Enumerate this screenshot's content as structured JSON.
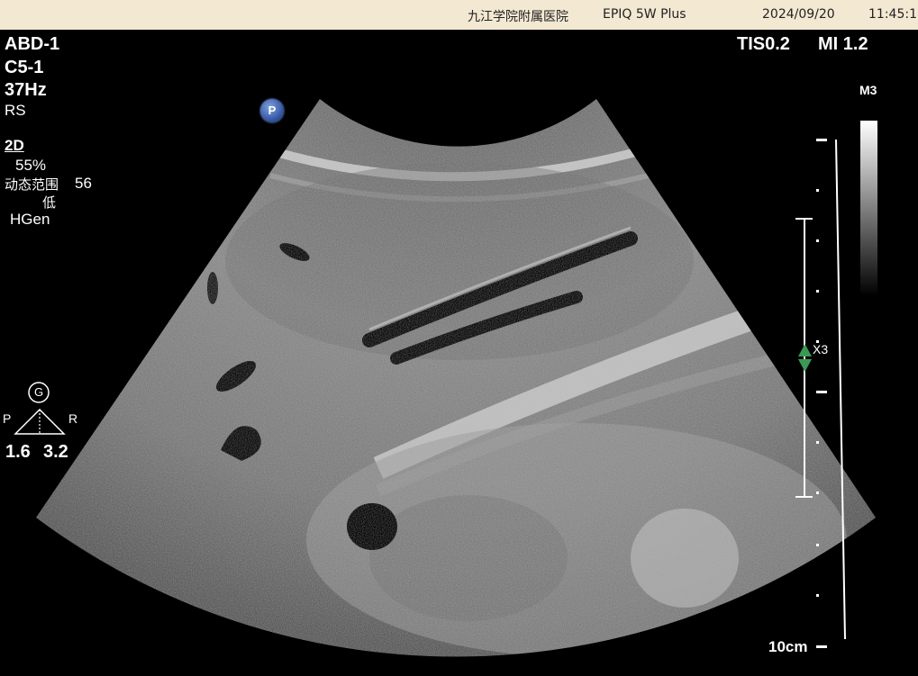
{
  "header": {
    "hospital": "九江学院附属医院",
    "device": "EPIQ 5W Plus",
    "date": "2024/09/20",
    "time": "11:45:17"
  },
  "left_panel": {
    "preset": "ABD-1",
    "probe": "C5-1",
    "frequency": "37Hz",
    "resolution": "RS",
    "mode": "2D",
    "gain": "55%",
    "dynamic_range_label": "动态范围",
    "dynamic_range_value": "56",
    "level": "低",
    "harmonic": "HGen"
  },
  "orientation": {
    "g_label": "G",
    "p_label": "P",
    "r_label": "R",
    "p_value": "1.6",
    "r_value": "3.2"
  },
  "right_panel": {
    "tis": "TIS0.2",
    "mi": "MI 1.2",
    "map": "M3",
    "focus_marker": "X3",
    "depth": "10cm"
  },
  "probe_badge": "P",
  "colors": {
    "header_bg": "#f3e8d2",
    "focus_arrow": "#3a9a55"
  }
}
